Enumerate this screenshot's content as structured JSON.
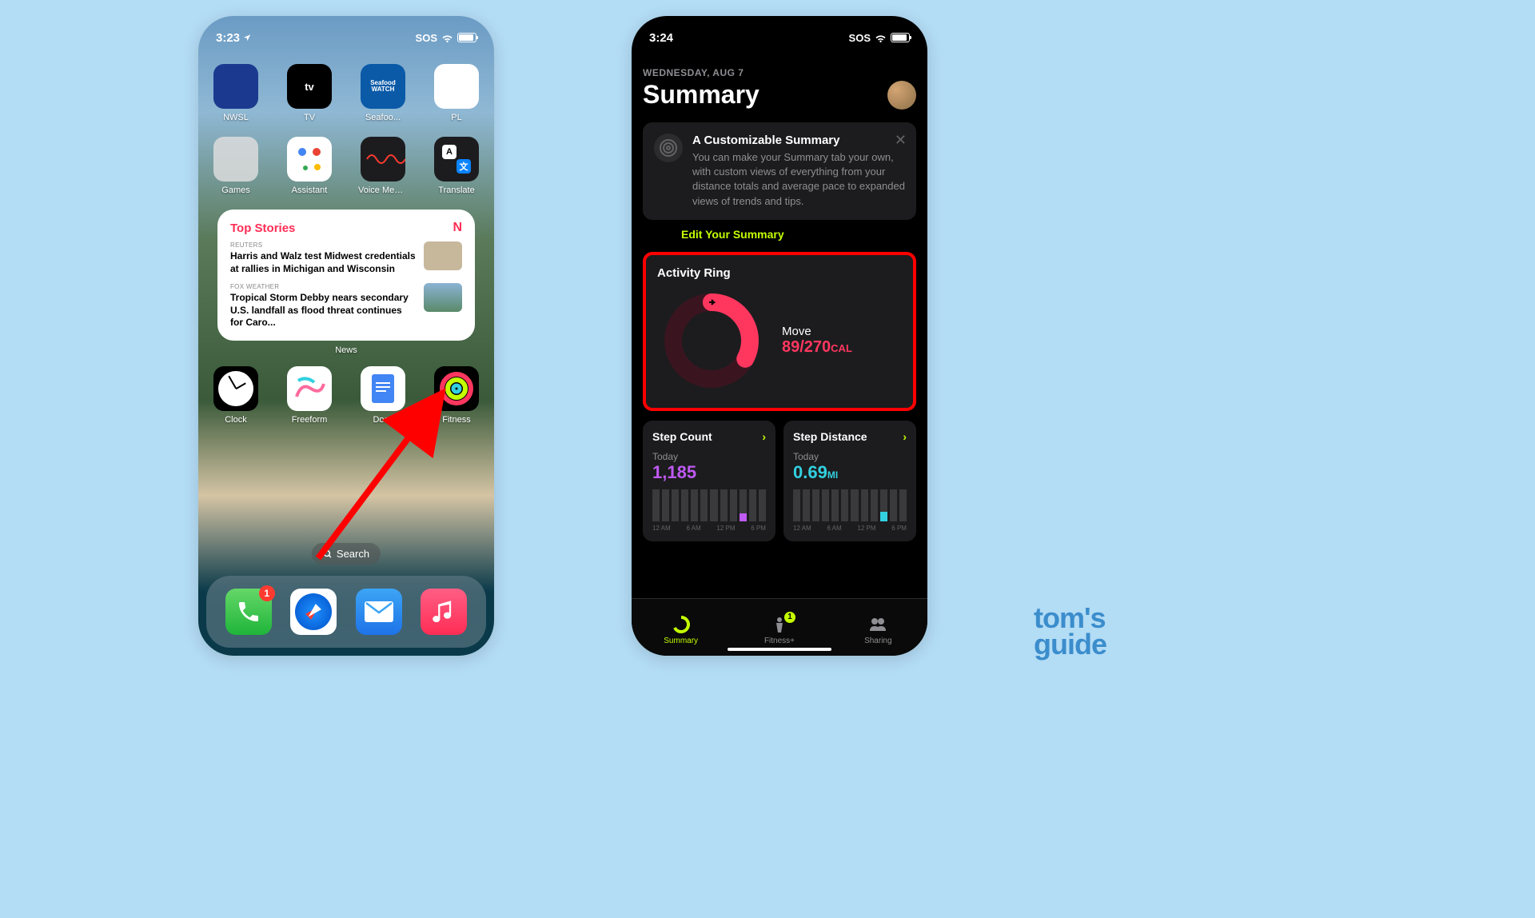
{
  "left": {
    "status": {
      "time": "3:23",
      "sos": "SOS"
    },
    "apps_row1": [
      {
        "label": "NWSL",
        "color": "#1b3a8f"
      },
      {
        "label": "TV",
        "color": "#000"
      },
      {
        "label": "Seafoo...",
        "color": "#0a5aa8",
        "text": "Seafood WATCH"
      },
      {
        "label": "PL",
        "color": "#fff"
      }
    ],
    "apps_row2": [
      {
        "label": "Games",
        "color": "#e8e8e8"
      },
      {
        "label": "Assistant",
        "color": "#fff"
      },
      {
        "label": "Voice Memos",
        "color": "#000"
      },
      {
        "label": "Translate",
        "color": "#1c1c1e"
      }
    ],
    "news": {
      "title": "Top Stories",
      "widget_label": "News",
      "items": [
        {
          "source": "REUTERS",
          "headline": "Harris and Walz test Midwest credentials at rallies in Michigan and Wisconsin"
        },
        {
          "source": "FOX WEATHER",
          "headline": "Tropical Storm Debby nears secondary U.S. landfall as flood threat continues for Caro..."
        }
      ]
    },
    "apps_row3": [
      {
        "label": "Clock",
        "color": "#000"
      },
      {
        "label": "Freeform",
        "color": "#fff"
      },
      {
        "label": "Docs",
        "color": "#fff"
      },
      {
        "label": "Fitness",
        "color": "#000"
      }
    ],
    "search": "Search",
    "dock_badge": "1"
  },
  "right": {
    "status": {
      "time": "3:24",
      "sos": "SOS"
    },
    "date": "WEDNESDAY, AUG 7",
    "title": "Summary",
    "info": {
      "title": "A Customizable Summary",
      "desc": "You can make your Summary tab your own, with custom views of everything from your distance totals and average pace to expanded views of trends and tips.",
      "link": "Edit Your Summary"
    },
    "activity": {
      "title": "Activity Ring",
      "move_label": "Move",
      "move_value": "89/270",
      "move_unit": "CAL"
    },
    "steps": {
      "title": "Step Count",
      "today_label": "Today",
      "value": "1,185",
      "times": [
        "12 AM",
        "6 AM",
        "12 PM",
        "6 PM"
      ]
    },
    "distance": {
      "title": "Step Distance",
      "today_label": "Today",
      "value": "0.69",
      "unit": "MI",
      "times": [
        "12 AM",
        "6 AM",
        "12 PM",
        "6 PM"
      ]
    },
    "tabs": [
      {
        "label": "Summary",
        "active": true
      },
      {
        "label": "Fitness+",
        "badge": "1"
      },
      {
        "label": "Sharing"
      }
    ]
  },
  "watermark": {
    "line1": "tom's",
    "line2": "guide"
  }
}
